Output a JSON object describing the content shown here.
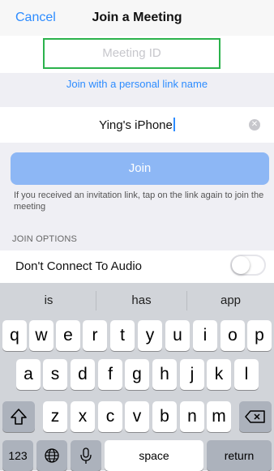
{
  "nav": {
    "cancel": "Cancel",
    "title": "Join a Meeting"
  },
  "meeting_id": {
    "placeholder": "Meeting ID",
    "value": ""
  },
  "personal_link": "Join with a personal link name",
  "name_field": {
    "value": "Ying's iPhone"
  },
  "join_button": "Join",
  "hint": "If you received an invitation link, tap on the link again to join the meeting",
  "join_options_header": "JOIN OPTIONS",
  "audio_option": {
    "label": "Don't Connect To Audio",
    "enabled": false
  },
  "keyboard": {
    "suggestions": [
      "is",
      "has",
      "app"
    ],
    "row1": [
      "q",
      "w",
      "e",
      "r",
      "t",
      "y",
      "u",
      "i",
      "o",
      "p"
    ],
    "row2": [
      "a",
      "s",
      "d",
      "f",
      "g",
      "h",
      "j",
      "k",
      "l"
    ],
    "row3": [
      "z",
      "x",
      "c",
      "v",
      "b",
      "n",
      "m"
    ],
    "numbers_key": "123",
    "space_key": "space",
    "return_key": "return"
  },
  "colors": {
    "accent": "#2d8cff",
    "focus_border": "#2bb24c",
    "join_button_disabled": "#8db7f5"
  }
}
